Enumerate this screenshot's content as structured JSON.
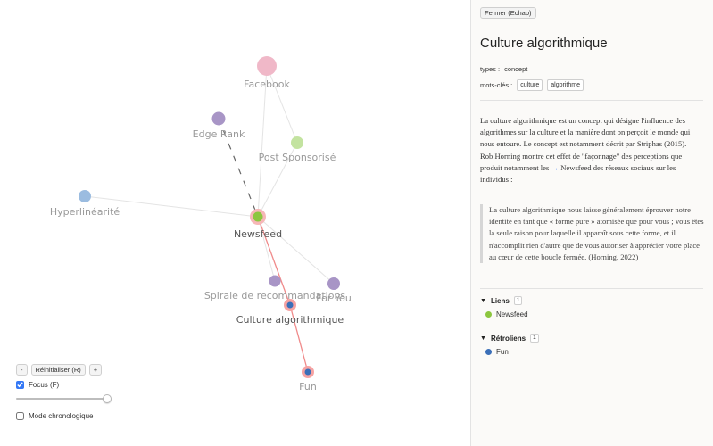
{
  "graph": {
    "nodes": [
      {
        "id": "facebook",
        "label": "Facebook",
        "color": "#f0b8c8"
      },
      {
        "id": "edgerank",
        "label": "Edge Rank",
        "color": "#a895c6"
      },
      {
        "id": "postsponso",
        "label": "Post Sponsorisé",
        "color": "#c3e3a0"
      },
      {
        "id": "hyperlinearite",
        "label": "Hyperlinéarité",
        "color": "#9bbce0"
      },
      {
        "id": "newsfeed",
        "label": "Newsfeed",
        "color": "#8cc63f"
      },
      {
        "id": "spirale",
        "label": "Spirale de recommandations",
        "color": "#a895c6"
      },
      {
        "id": "foryou",
        "label": "For You",
        "color": "#a895c6"
      },
      {
        "id": "culture",
        "label": "Culture algorithmique",
        "color": "#3b6fb8"
      },
      {
        "id": "fun",
        "label": "Fun",
        "color": "#3b6fb8"
      }
    ],
    "highlight_color": "#f08a8a"
  },
  "controls": {
    "zoom_out": "-",
    "reset": "Réinitialiser (R)",
    "zoom_in": "+",
    "focus": "Focus (F)",
    "chrono": "Mode chronologique"
  },
  "panel": {
    "close": "Fermer (Echap)",
    "title": "Culture algorithmique",
    "types_label": "types :",
    "types_value": "concept",
    "keywords_label": "mots-clés :",
    "keywords": [
      "culture",
      "algorithme"
    ],
    "para1": "La culture algorithmique est un concept qui désigne l'influence des algorithmes sur la culture et la manière dont on perçoit le monde qui nous entoure. Le concept est notamment décrit par Striphas (2015).",
    "para2_before": "Rob Horning montre cet effet de \"façonnage\" des perceptions que produit notamment les ",
    "para2_arrow": "→",
    "para2_after": " Newsfeed des réseaux sociaux sur les individus :",
    "quote": "La culture algorithmique nous laisse généralement éprouver notre identité en tant que « forme pure » atomisée que pour vous ; vous êtes la seule raison pour laquelle il apparaît sous cette forme, et il n'accomplit rien d'autre que de vous autoriser à apprécier votre place au cœur de cette boucle fermée. (Horning, 2022)",
    "links_title": "Liens",
    "links_count": "1",
    "links": [
      {
        "label": "Newsfeed",
        "color": "#8cc63f"
      }
    ],
    "backlinks_title": "Rétroliens",
    "backlinks_count": "1",
    "backlinks": [
      {
        "label": "Fun",
        "color": "#3b6fb8"
      }
    ]
  }
}
